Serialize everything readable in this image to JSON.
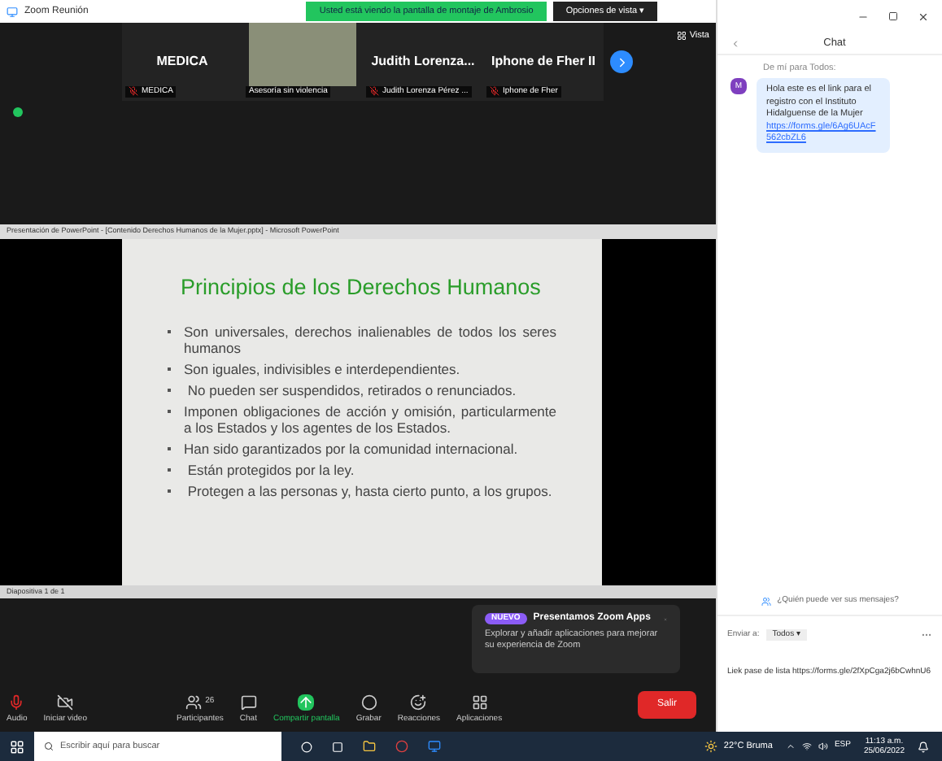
{
  "window": {
    "title": "Zoom Reunión"
  },
  "share_banner": {
    "text": "Usted está viendo la pantalla de montaje de Ambrosio",
    "view_options": "Opciones de vista ▾"
  },
  "video_tiles": [
    {
      "kind": "name",
      "name": "MEDICA",
      "label": "MEDICA",
      "muted": true
    },
    {
      "kind": "video",
      "label": "Asesoría sin violencia",
      "muted": false
    },
    {
      "kind": "name",
      "name": "Judith Lorenza...",
      "label": "Judith Lorenza Pérez ...",
      "muted": true
    },
    {
      "kind": "name",
      "name": "Iphone de Fher II",
      "label": "Iphone de Fher",
      "muted": true
    }
  ],
  "view_button": "Vista",
  "shared_window": {
    "title": "Presentación de PowerPoint - [Contenido Derechos Humanos de la Mujer.pptx] - Microsoft PowerPoint",
    "slide_title": "Principios de  los Derechos Humanos",
    "bullets": [
      "Son universales, derechos inalienables de todos los seres humanos",
      "Son iguales, indivisibles e interdependientes.",
      " No pueden ser suspendidos, retirados o renunciados.",
      "Imponen obligaciones de acción y omisión, particularmente a los Estados y los agentes de los Estados.",
      "Han sido garantizados por la comunidad internacional.",
      " Están protegidos por la ley.",
      " Protegen a las personas y, hasta cierto punto, a los grupos."
    ],
    "status": "Diapositiva 1 de 1"
  },
  "notification": {
    "badge": "NUEVO",
    "title": "Presentamos Zoom Apps",
    "body": "Explorar y añadir aplicaciones para mejorar su experiencia de Zoom"
  },
  "toolbar": [
    {
      "kind": "audio",
      "label": "Audio",
      "highlighted": false
    },
    {
      "kind": "video",
      "label": "Iniciar video",
      "highlighted": false
    },
    {
      "kind": "participants",
      "label": "Participantes",
      "count": "26",
      "highlighted": false
    },
    {
      "kind": "chat",
      "label": "Chat",
      "highlighted": false
    },
    {
      "kind": "share",
      "label": "Compartir pantalla",
      "highlighted": true
    },
    {
      "kind": "record",
      "label": "Grabar",
      "highlighted": false
    },
    {
      "kind": "reactions",
      "label": "Reacciones",
      "highlighted": false
    },
    {
      "kind": "apps",
      "label": "Aplicaciones",
      "highlighted": false
    }
  ],
  "leave_button": "Salir",
  "chat": {
    "title": "Chat",
    "sender_line": "De mí para Todos:",
    "messages": [
      {
        "avatar": "M",
        "text": "Hola este es el link para el registro con el Instituto Hidalguense de la Mujer",
        "link": "https://forms.gle/6Ag6UAcF562cbZL6"
      }
    ],
    "who_can_see": "¿Quién puede ver sus mensajes?",
    "send_to_label": "Enviar a:",
    "recipient": "Todos ▾",
    "draft": "Liek pase de lista https://forms.gle/2fXpCga2j6bCwhnU6"
  },
  "taskbar": {
    "search_placeholder": "Escribir aquí para buscar",
    "weather": "22°C Bruma",
    "language": "ESP",
    "time": "11:13 a.m.",
    "date": "25/06/2022"
  }
}
